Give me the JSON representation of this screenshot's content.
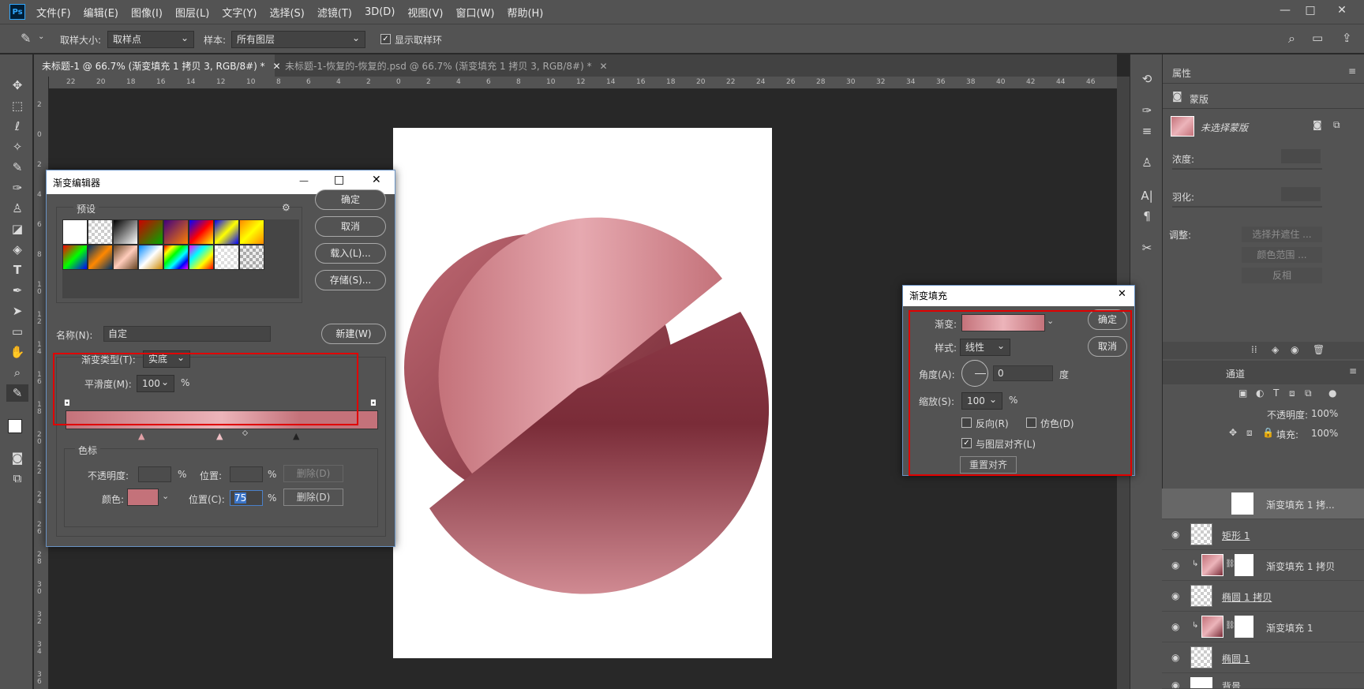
{
  "app": {
    "logo": "Ps"
  },
  "menu": [
    "文件(F)",
    "编辑(E)",
    "图像(I)",
    "图层(L)",
    "文字(Y)",
    "选择(S)",
    "滤镜(T)",
    "3D(D)",
    "视图(V)",
    "窗口(W)",
    "帮助(H)"
  ],
  "window_controls": {
    "minimize": "—",
    "restore": "□",
    "close": "✕"
  },
  "options": {
    "sample_size_label": "取样大小:",
    "sample_size_value": "取样点",
    "sample_label": "样本:",
    "sample_value": "所有图层",
    "show_ring_label": "显示取样环"
  },
  "tabs": [
    {
      "label": "未标题-1 @ 66.7% (渐变填充 1 拷贝 3, RGB/8#) *",
      "close": "✕"
    },
    {
      "label": "未标题-1-恢复的-恢复的.psd @ 66.7% (渐变填充 1 拷贝 3, RGB/8#) *",
      "close": "✕"
    }
  ],
  "ruler_h": [
    "22",
    "20",
    "18",
    "16",
    "14",
    "12",
    "10",
    "8",
    "6",
    "4",
    "2",
    "0",
    "2",
    "4",
    "6",
    "8",
    "10",
    "12",
    "14",
    "16",
    "18",
    "20",
    "22",
    "24",
    "26",
    "28",
    "30",
    "32",
    "34",
    "36",
    "38",
    "40",
    "42",
    "44",
    "46"
  ],
  "ruler_v": [
    "2",
    "0",
    "2",
    "4",
    "6",
    "8",
    "1\n0",
    "1\n2",
    "1\n4",
    "1\n6",
    "1\n8",
    "2\n0",
    "2\n2",
    "2\n4",
    "2\n6",
    "2\n8",
    "3\n0",
    "3\n2",
    "3\n4",
    "3\n6"
  ],
  "tools": [
    "move-icon",
    "marquee-icon",
    "lasso-icon",
    "quick-select-icon",
    "eyedropper-icon",
    "brush-icon",
    "stamp-icon",
    "eraser-icon",
    "bucket-icon",
    "type-icon",
    "pen-icon",
    "path-select-icon",
    "rect-icon",
    "hand-icon",
    "zoom-icon",
    "eyedropper-icon"
  ],
  "gradient_editor": {
    "title": "渐变编辑器",
    "presets_label": "预设",
    "ok": "确定",
    "cancel": "取消",
    "load": "载入(L)...",
    "save": "存储(S)...",
    "name_label": "名称(N):",
    "name_value": "自定",
    "new": "新建(W)",
    "type_label": "渐变类型(T):",
    "type_value": "实底",
    "smooth_label": "平滑度(M):",
    "smooth_value": "100",
    "smooth_unit": "%",
    "stops_label": "色标",
    "opacity_label": "不透明度:",
    "opacity_unit": "%",
    "location_label1": "位置:",
    "unit1": "%",
    "delete1": "删除(D)",
    "color_label": "颜色:",
    "location_label2": "位置(C):",
    "location_value": "75",
    "unit2": "%",
    "delete2": "删除(D)",
    "stop_color": "#c4727a"
  },
  "gradient_fill": {
    "title": "渐变填充",
    "gradient_label": "渐变:",
    "style_label": "样式:",
    "style_value": "线性",
    "angle_label": "角度(A):",
    "angle_value": "0",
    "angle_unit": "度",
    "scale_label": "缩放(S):",
    "scale_value": "100",
    "scale_unit": "%",
    "reverse_label": "反向(R)",
    "dither_label": "仿色(D)",
    "align_label": "与图层对齐(L)",
    "reset_label": "重置对齐",
    "ok": "确定",
    "cancel": "取消"
  },
  "properties": {
    "tab": "属性",
    "mask_label": "蒙版",
    "no_mask": "未选择蒙版",
    "density_label": "浓度:",
    "feather_label": "羽化:",
    "adjust_label": "调整:",
    "select_mask": "选择并遮住 ...",
    "color_range": "颜色范围 ...",
    "invert": "反相"
  },
  "layers_panel": {
    "channels_tab": "通道",
    "opacity_label": "不透明度:",
    "opacity_value": "100%",
    "fill_label": "填充:",
    "fill_value": "100%"
  },
  "layers": [
    {
      "name": "渐变填充 1 拷...",
      "type": "gradient",
      "selected": true
    },
    {
      "name": "矩形 1",
      "type": "shape",
      "selected": false
    },
    {
      "name": "渐变填充 1 拷贝",
      "type": "gradient",
      "selected": false
    },
    {
      "name": "椭圆 1 拷贝",
      "type": "shape",
      "selected": false
    },
    {
      "name": "渐变填充 1",
      "type": "gradient",
      "selected": false
    },
    {
      "name": "椭圆 1",
      "type": "shape",
      "selected": false
    },
    {
      "name": "背景",
      "type": "background",
      "selected": false
    }
  ],
  "colors": {
    "rose": "#c4727a",
    "highlight": "#ecb4ba",
    "dark": "#7a2c38",
    "selection_red": "#e00000"
  }
}
